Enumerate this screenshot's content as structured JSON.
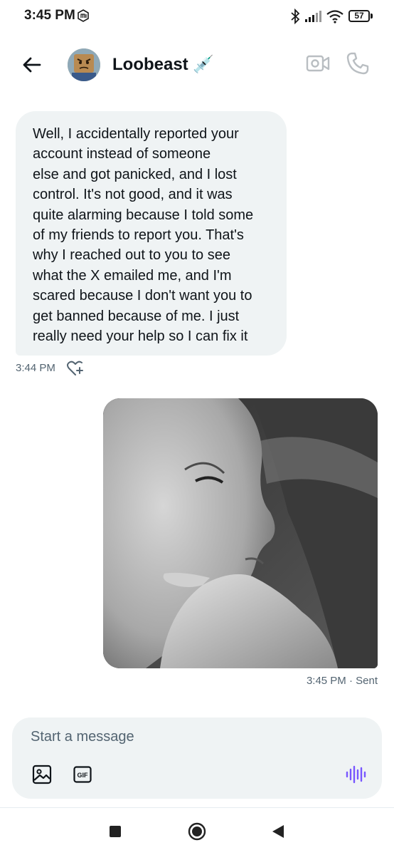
{
  "status_bar": {
    "time": "3:45 PM",
    "battery": "57"
  },
  "header": {
    "contact_name": "Loobeast 💉"
  },
  "received_message": {
    "lines": [
      "Well, I accidentally reported your",
      "account instead of someone",
      "else and got panicked, and I lost",
      "control. It's not good, and it was",
      "quite alarming because I told some",
      "of my friends to report you. That's",
      "why I reached out to you to see",
      "what the X emailed me, and I'm",
      "scared because I don't want you to",
      "get banned because of me. I just",
      "really need your help so I can fix it"
    ],
    "timestamp": "3:44 PM"
  },
  "sent_message": {
    "meta": "3:45 PM · Sent"
  },
  "composer": {
    "placeholder": "Start a message",
    "gif_label": "GIF"
  },
  "colors": {
    "accent": "#1d9bf0",
    "bubble": "#eff3f4",
    "muted": "#536471",
    "voice": "#7856ff"
  }
}
